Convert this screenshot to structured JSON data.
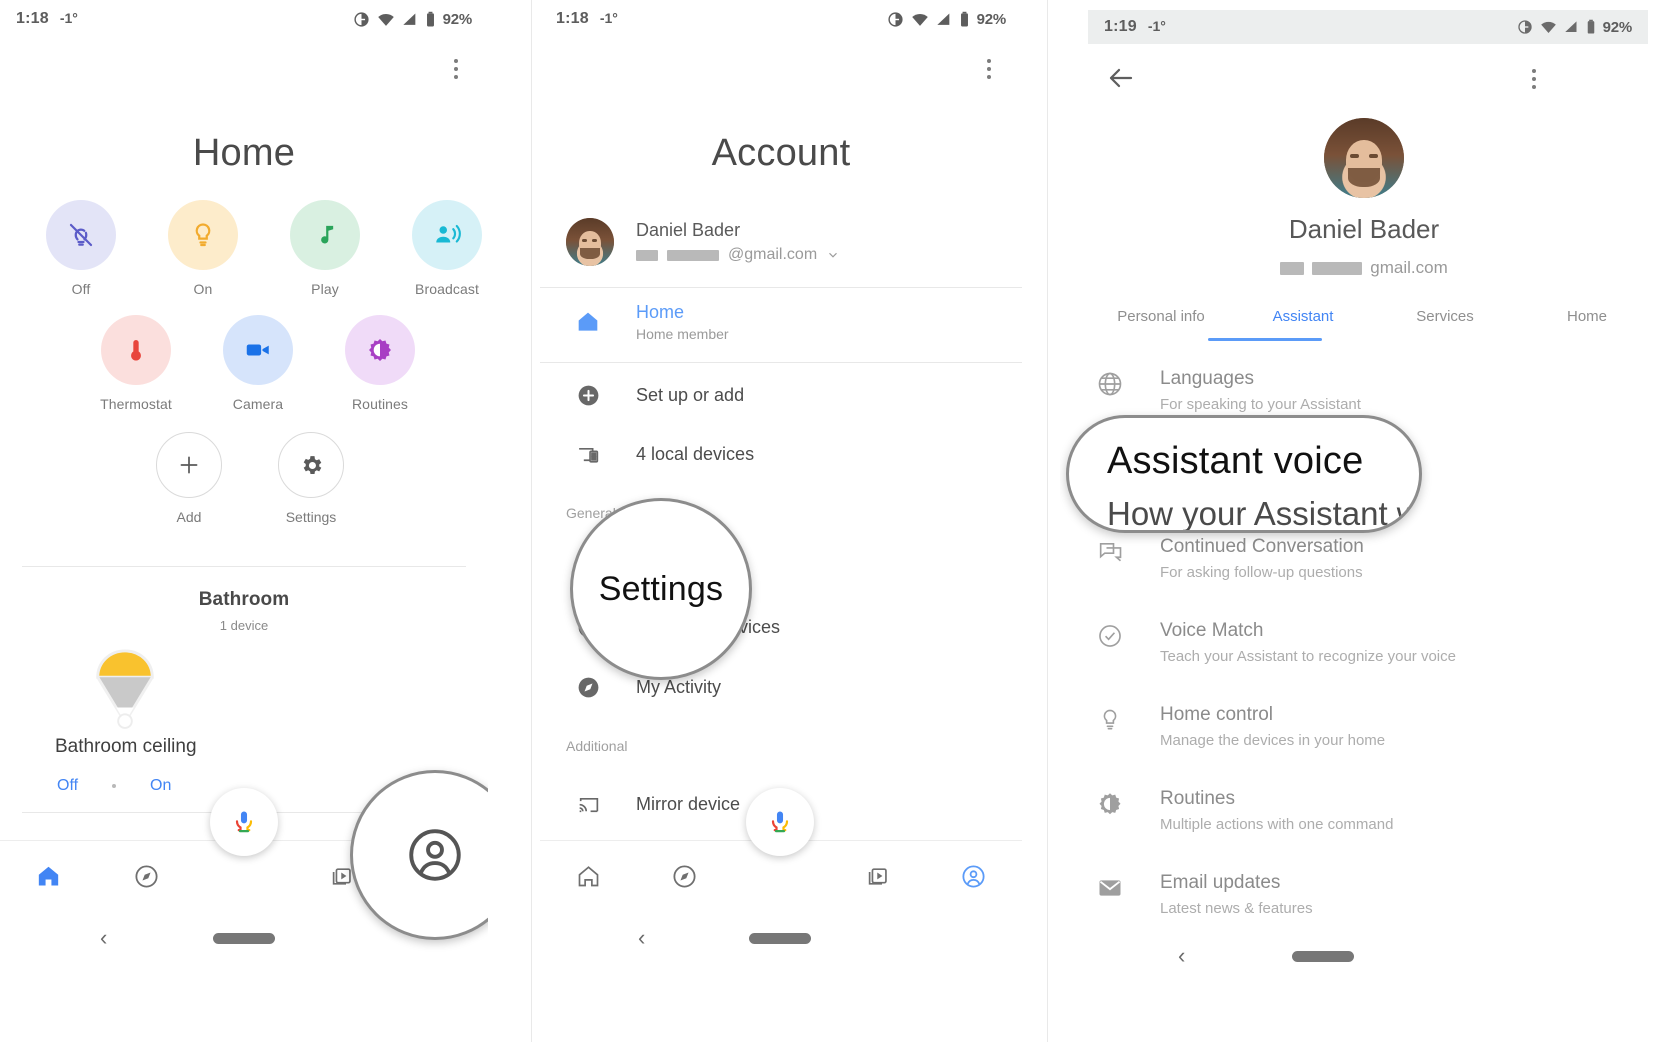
{
  "statusbars": {
    "panel1": {
      "time": "1:18",
      "temp": "-1°",
      "battery": "92%"
    },
    "panel2": {
      "time": "1:18",
      "temp": "-1°",
      "battery": "92%"
    },
    "panel3": {
      "time": "1:19",
      "temp": "-1°",
      "battery": "92%"
    }
  },
  "colors": {
    "accent_blue": "#4285f4",
    "tab_blue": "#5b9bf8",
    "tile_off_bg": "#e3e4f7",
    "tile_off_fg": "#5b5bc8",
    "tile_on_bg": "#fdeccb",
    "tile_on_fg": "#f2ab2e",
    "tile_play_bg": "#d9f0e1",
    "tile_play_fg": "#2aa45a",
    "tile_broadcast_bg": "#d6f1f7",
    "tile_broadcast_fg": "#19b9d4",
    "tile_thermostat_bg": "#fbdfdd",
    "tile_thermostat_fg": "#e8453c",
    "tile_camera_bg": "#d6e4fb",
    "tile_camera_fg": "#1b72e8",
    "tile_routines_bg": "#f0dbf8",
    "tile_routines_fg": "#a83fc4",
    "bulb_on": "#f9c22e"
  },
  "home": {
    "title": "Home",
    "overflow_icon": "more-vertical-icon",
    "quick_tiles": [
      {
        "label": "Off",
        "icon": "bulb-off-icon"
      },
      {
        "label": "On",
        "icon": "bulb-on-icon"
      },
      {
        "label": "Play",
        "icon": "music-note-icon"
      },
      {
        "label": "Broadcast",
        "icon": "broadcast-icon"
      }
    ],
    "quick_tiles_row2": [
      {
        "label": "Thermostat",
        "icon": "thermometer-icon"
      },
      {
        "label": "Camera",
        "icon": "video-camera-icon"
      },
      {
        "label": "Routines",
        "icon": "routines-gear-icon"
      }
    ],
    "outline_tiles": [
      {
        "label": "Add",
        "icon": "plus-icon"
      },
      {
        "label": "Settings",
        "icon": "gear-icon"
      }
    ],
    "room": {
      "name": "Bathroom",
      "device_count": "1 device"
    },
    "device": {
      "name": "Bathroom ceiling",
      "off_label": "Off",
      "on_label": "On",
      "icon": "ceiling-light-icon"
    },
    "bottom_nav": [
      {
        "name": "home",
        "icon": "home-icon",
        "active": true
      },
      {
        "name": "explore",
        "icon": "compass-icon",
        "active": false
      },
      {
        "name": "media",
        "icon": "media-stack-icon",
        "active": false
      },
      {
        "name": "account",
        "icon": "account-circle-icon",
        "active": false
      }
    ],
    "mic_icon": "google-mic-icon",
    "magnifier": {
      "target": "account-tab",
      "icon": "account-circle-icon"
    }
  },
  "account": {
    "title": "Account",
    "overflow_icon": "more-vertical-icon",
    "user": {
      "name": "Daniel Bader",
      "email_suffix": "@gmail.com",
      "chevron": "chevron-down-icon"
    },
    "rows": [
      {
        "label": "Home",
        "sub": "Home member",
        "icon": "home-filled-icon",
        "highlight": true
      },
      {
        "label": "Set up or add",
        "sub": "",
        "icon": "plus-circle-icon",
        "highlight": false
      },
      {
        "label": "4 local devices",
        "sub": "",
        "icon": "cast-device-icon",
        "highlight": false
      }
    ],
    "section_general": "General",
    "general_rows": [
      {
        "label": "Settings",
        "icon": "gear-icon"
      },
      {
        "label": "Assistant services",
        "icon": "person-circle-icon"
      },
      {
        "label": "My Activity",
        "icon": "compass-filled-icon"
      }
    ],
    "section_additional": "Additional",
    "additional_rows": [
      {
        "label": "Mirror device",
        "icon": "cast-icon"
      }
    ],
    "bottom_nav": [
      {
        "name": "home",
        "icon": "home-icon",
        "active": false
      },
      {
        "name": "explore",
        "icon": "compass-icon",
        "active": false
      },
      {
        "name": "media",
        "icon": "media-stack-icon",
        "active": false
      },
      {
        "name": "account",
        "icon": "account-circle-icon",
        "active": true
      }
    ],
    "mic_icon": "google-mic-icon",
    "magnifier": {
      "label": "Settings"
    }
  },
  "assistant": {
    "back_icon": "arrow-left-icon",
    "overflow_icon": "more-vertical-icon",
    "user": {
      "name": "Daniel Bader",
      "email_suffix": "gmail.com"
    },
    "tabs": [
      {
        "label": "Personal info",
        "active": false
      },
      {
        "label": "Assistant",
        "active": true
      },
      {
        "label": "Services",
        "active": false
      },
      {
        "label": "Home",
        "active": false
      }
    ],
    "rows": [
      {
        "label": "Languages",
        "sub": "For speaking to your Assistant",
        "icon": "globe-icon"
      },
      {
        "label": "Assistant voice",
        "sub": "How your Assistant will sound",
        "icon": "speaker-icon"
      },
      {
        "label": "Continued Conversation",
        "sub": "For asking follow-up questions",
        "icon": "chat-icon"
      },
      {
        "label": "Voice Match",
        "sub": "Teach your Assistant to recognize your voice",
        "icon": "check-circle-icon"
      },
      {
        "label": "Home control",
        "sub": "Manage the devices in your home",
        "icon": "bulb-outline-icon"
      },
      {
        "label": "Routines",
        "sub": "Multiple actions with one command",
        "icon": "routines-gear-icon"
      },
      {
        "label": "Email updates",
        "sub": "Latest news & features",
        "icon": "mail-icon"
      }
    ],
    "magnifier": {
      "line1": "Assistant voice",
      "line2": "How your Assistant wil"
    }
  },
  "gesture_bar": {
    "back_glyph": "‹",
    "pill": "home-pill"
  }
}
